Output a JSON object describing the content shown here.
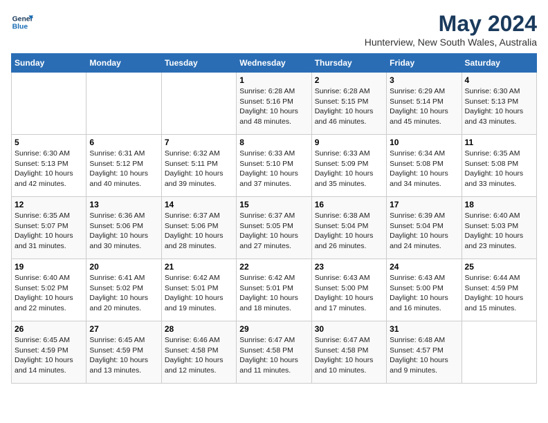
{
  "header": {
    "logo_line1": "General",
    "logo_line2": "Blue",
    "title": "May 2024",
    "subtitle": "Hunterview, New South Wales, Australia"
  },
  "days_of_week": [
    "Sunday",
    "Monday",
    "Tuesday",
    "Wednesday",
    "Thursday",
    "Friday",
    "Saturday"
  ],
  "weeks": [
    [
      {
        "day": "",
        "info": ""
      },
      {
        "day": "",
        "info": ""
      },
      {
        "day": "",
        "info": ""
      },
      {
        "day": "1",
        "info": "Sunrise: 6:28 AM\nSunset: 5:16 PM\nDaylight: 10 hours\nand 48 minutes."
      },
      {
        "day": "2",
        "info": "Sunrise: 6:28 AM\nSunset: 5:15 PM\nDaylight: 10 hours\nand 46 minutes."
      },
      {
        "day": "3",
        "info": "Sunrise: 6:29 AM\nSunset: 5:14 PM\nDaylight: 10 hours\nand 45 minutes."
      },
      {
        "day": "4",
        "info": "Sunrise: 6:30 AM\nSunset: 5:13 PM\nDaylight: 10 hours\nand 43 minutes."
      }
    ],
    [
      {
        "day": "5",
        "info": "Sunrise: 6:30 AM\nSunset: 5:13 PM\nDaylight: 10 hours\nand 42 minutes."
      },
      {
        "day": "6",
        "info": "Sunrise: 6:31 AM\nSunset: 5:12 PM\nDaylight: 10 hours\nand 40 minutes."
      },
      {
        "day": "7",
        "info": "Sunrise: 6:32 AM\nSunset: 5:11 PM\nDaylight: 10 hours\nand 39 minutes."
      },
      {
        "day": "8",
        "info": "Sunrise: 6:33 AM\nSunset: 5:10 PM\nDaylight: 10 hours\nand 37 minutes."
      },
      {
        "day": "9",
        "info": "Sunrise: 6:33 AM\nSunset: 5:09 PM\nDaylight: 10 hours\nand 35 minutes."
      },
      {
        "day": "10",
        "info": "Sunrise: 6:34 AM\nSunset: 5:08 PM\nDaylight: 10 hours\nand 34 minutes."
      },
      {
        "day": "11",
        "info": "Sunrise: 6:35 AM\nSunset: 5:08 PM\nDaylight: 10 hours\nand 33 minutes."
      }
    ],
    [
      {
        "day": "12",
        "info": "Sunrise: 6:35 AM\nSunset: 5:07 PM\nDaylight: 10 hours\nand 31 minutes."
      },
      {
        "day": "13",
        "info": "Sunrise: 6:36 AM\nSunset: 5:06 PM\nDaylight: 10 hours\nand 30 minutes."
      },
      {
        "day": "14",
        "info": "Sunrise: 6:37 AM\nSunset: 5:06 PM\nDaylight: 10 hours\nand 28 minutes."
      },
      {
        "day": "15",
        "info": "Sunrise: 6:37 AM\nSunset: 5:05 PM\nDaylight: 10 hours\nand 27 minutes."
      },
      {
        "day": "16",
        "info": "Sunrise: 6:38 AM\nSunset: 5:04 PM\nDaylight: 10 hours\nand 26 minutes."
      },
      {
        "day": "17",
        "info": "Sunrise: 6:39 AM\nSunset: 5:04 PM\nDaylight: 10 hours\nand 24 minutes."
      },
      {
        "day": "18",
        "info": "Sunrise: 6:40 AM\nSunset: 5:03 PM\nDaylight: 10 hours\nand 23 minutes."
      }
    ],
    [
      {
        "day": "19",
        "info": "Sunrise: 6:40 AM\nSunset: 5:02 PM\nDaylight: 10 hours\nand 22 minutes."
      },
      {
        "day": "20",
        "info": "Sunrise: 6:41 AM\nSunset: 5:02 PM\nDaylight: 10 hours\nand 20 minutes."
      },
      {
        "day": "21",
        "info": "Sunrise: 6:42 AM\nSunset: 5:01 PM\nDaylight: 10 hours\nand 19 minutes."
      },
      {
        "day": "22",
        "info": "Sunrise: 6:42 AM\nSunset: 5:01 PM\nDaylight: 10 hours\nand 18 minutes."
      },
      {
        "day": "23",
        "info": "Sunrise: 6:43 AM\nSunset: 5:00 PM\nDaylight: 10 hours\nand 17 minutes."
      },
      {
        "day": "24",
        "info": "Sunrise: 6:43 AM\nSunset: 5:00 PM\nDaylight: 10 hours\nand 16 minutes."
      },
      {
        "day": "25",
        "info": "Sunrise: 6:44 AM\nSunset: 4:59 PM\nDaylight: 10 hours\nand 15 minutes."
      }
    ],
    [
      {
        "day": "26",
        "info": "Sunrise: 6:45 AM\nSunset: 4:59 PM\nDaylight: 10 hours\nand 14 minutes."
      },
      {
        "day": "27",
        "info": "Sunrise: 6:45 AM\nSunset: 4:59 PM\nDaylight: 10 hours\nand 13 minutes."
      },
      {
        "day": "28",
        "info": "Sunrise: 6:46 AM\nSunset: 4:58 PM\nDaylight: 10 hours\nand 12 minutes."
      },
      {
        "day": "29",
        "info": "Sunrise: 6:47 AM\nSunset: 4:58 PM\nDaylight: 10 hours\nand 11 minutes."
      },
      {
        "day": "30",
        "info": "Sunrise: 6:47 AM\nSunset: 4:58 PM\nDaylight: 10 hours\nand 10 minutes."
      },
      {
        "day": "31",
        "info": "Sunrise: 6:48 AM\nSunset: 4:57 PM\nDaylight: 10 hours\nand 9 minutes."
      },
      {
        "day": "",
        "info": ""
      }
    ]
  ]
}
